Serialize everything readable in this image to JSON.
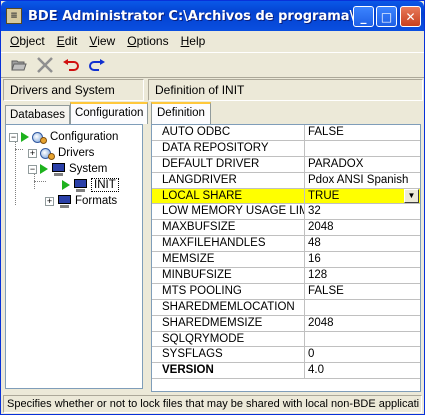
{
  "window": {
    "title": "BDE Administrator  C:\\Archivos de programa\\Com..."
  },
  "menu": [
    {
      "label": "Object",
      "accel": "O",
      "rest": "bject"
    },
    {
      "label": "Edit",
      "accel": "E",
      "rest": "dit"
    },
    {
      "label": "View",
      "accel": "V",
      "rest": "iew"
    },
    {
      "label": "Options",
      "accel": "O",
      "rest": "ptions"
    },
    {
      "label": "Help",
      "accel": "H",
      "rest": "elp"
    }
  ],
  "toolbar": {
    "open_icon": "folder-open-icon",
    "delete_icon": "delete-x-icon",
    "undo_icon": "undo-icon",
    "redo_icon": "redo-icon"
  },
  "left_header": "Drivers and System",
  "right_header": "Definition of INIT",
  "left_tabs": [
    "Databases",
    "Configuration"
  ],
  "active_left_tab": "Configuration",
  "tree": {
    "configuration": "Configuration",
    "drivers": "Drivers",
    "system": "System",
    "init": "INIT",
    "formats": "Formats"
  },
  "definition_tab": "Definition",
  "grid": [
    {
      "name": "AUTO ODBC",
      "value": "FALSE"
    },
    {
      "name": "DATA REPOSITORY",
      "value": ""
    },
    {
      "name": "DEFAULT DRIVER",
      "value": "PARADOX"
    },
    {
      "name": "LANGDRIVER",
      "value": "Pdox ANSI Spanish"
    },
    {
      "name": "LOCAL SHARE",
      "value": "TRUE"
    },
    {
      "name": "LOW MEMORY USAGE LIMIT",
      "value": "32"
    },
    {
      "name": "MAXBUFSIZE",
      "value": "2048"
    },
    {
      "name": "MAXFILEHANDLES",
      "value": "48"
    },
    {
      "name": "MEMSIZE",
      "value": "16"
    },
    {
      "name": "MINBUFSIZE",
      "value": "128"
    },
    {
      "name": "MTS POOLING",
      "value": "FALSE"
    },
    {
      "name": "SHAREDMEMLOCATION",
      "value": ""
    },
    {
      "name": "SHAREDMEMSIZE",
      "value": "2048"
    },
    {
      "name": "SQLQRYMODE",
      "value": ""
    },
    {
      "name": "SYSFLAGS",
      "value": "0"
    },
    {
      "name": "VERSION",
      "value": "4.0"
    }
  ],
  "selected_row": "LOCAL SHARE",
  "highlight_color": "#ffff00",
  "status": "Specifies whether or not to lock files that may be shared with local non-BDE applicati"
}
